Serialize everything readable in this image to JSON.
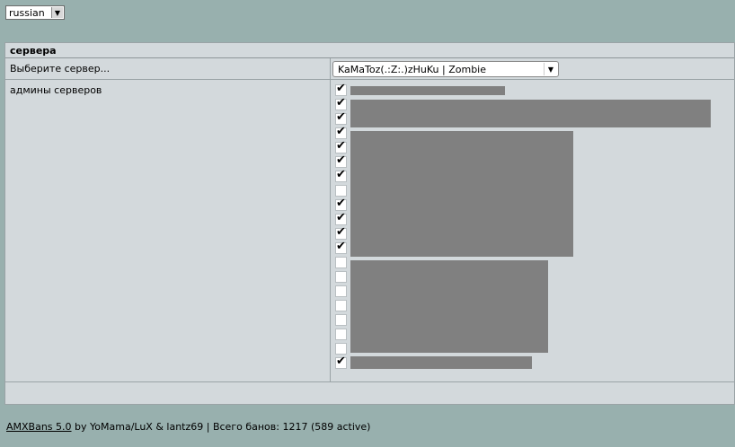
{
  "language_select": {
    "value": "russian"
  },
  "panel": {
    "title": "сервера",
    "server_label": "Выберите сервер...",
    "server_value": "KaMaToz(.:Z:.)zHuKu | Zombie",
    "admins_label": "админы серверов"
  },
  "admins": [
    {
      "checked": true
    },
    {
      "checked": true
    },
    {
      "checked": true
    },
    {
      "checked": true
    },
    {
      "checked": true
    },
    {
      "checked": true
    },
    {
      "checked": true
    },
    {
      "checked": false
    },
    {
      "checked": true
    },
    {
      "checked": true
    },
    {
      "checked": true
    },
    {
      "checked": true
    },
    {
      "checked": false
    },
    {
      "checked": false
    },
    {
      "checked": false
    },
    {
      "checked": false
    },
    {
      "checked": false
    },
    {
      "checked": false
    },
    {
      "checked": false
    },
    {
      "checked": true
    }
  ],
  "footer": {
    "link": "AMXBans 5.0",
    "text": " by YoMama/LuX & lantz69 | Всего банов: 1217 (589 active)"
  }
}
